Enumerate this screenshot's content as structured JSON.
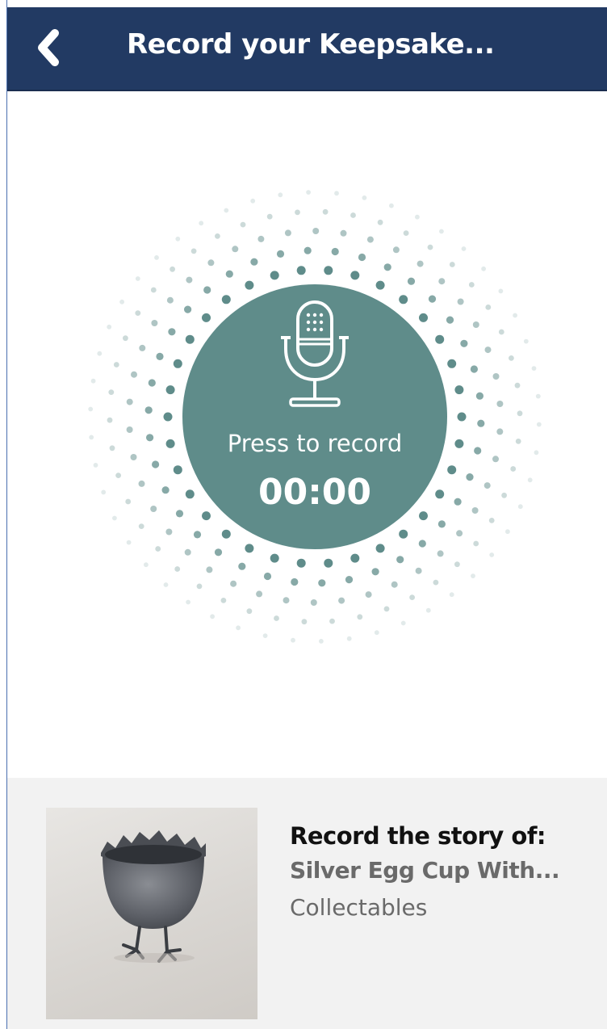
{
  "header": {
    "title": "Record your Keepsake...",
    "back_icon": "chevron-left-icon",
    "background_color": "#223a63"
  },
  "recorder": {
    "prompt": "Press to record",
    "timer": "00:00",
    "icon": "microphone-icon",
    "accent_color": "#5f8c8a"
  },
  "item": {
    "heading": "Record the story of:",
    "name": "Silver Egg Cup With...",
    "category": "Collectables",
    "photo_icon": "egg-cup-photo"
  }
}
